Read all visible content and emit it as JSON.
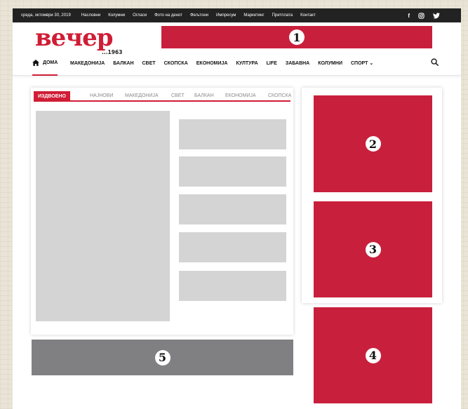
{
  "topbar": {
    "date": "среда, октомври 30, 2019",
    "links": [
      "Насловни",
      "Колумни",
      "Огласи",
      "Фото на денот",
      "Фељтони",
      "Импресум",
      "Маркетинг",
      "Претплата",
      "Контакт"
    ],
    "social_icons": [
      "facebook-icon",
      "instagram-icon",
      "twitter-icon"
    ],
    "facebook_glyph": "f"
  },
  "header": {
    "logo_text": "вечер",
    "logo_suffix": "...1963"
  },
  "nav": {
    "home_label": "ДОМА",
    "items": [
      "МАКЕДОНИЈА",
      "БАЛКАН",
      "СВЕТ",
      "СКОПСКА",
      "ЕКОНОМИЈА",
      "КУЛТУРА",
      "LIFE",
      "ЗАБАВНА",
      "КОЛУМНИ",
      "СПОРТ ⌄"
    ]
  },
  "tabs": {
    "active": "ИЗДВОЕНО",
    "items": [
      "НАЈНОВИ",
      "МАКЕДОНИЈА",
      "СВЕТ",
      "БАЛКАН",
      "ЕКОНОМИЈА",
      "СКОПСКА"
    ]
  },
  "banners": {
    "b1": "1",
    "b2": "2",
    "b3": "3",
    "b4": "4",
    "b5": "5"
  },
  "colors": {
    "accent": "#d01d35",
    "banner": "#c8203c",
    "placeholder": "#d4d4d4",
    "topbar": "#222222"
  }
}
